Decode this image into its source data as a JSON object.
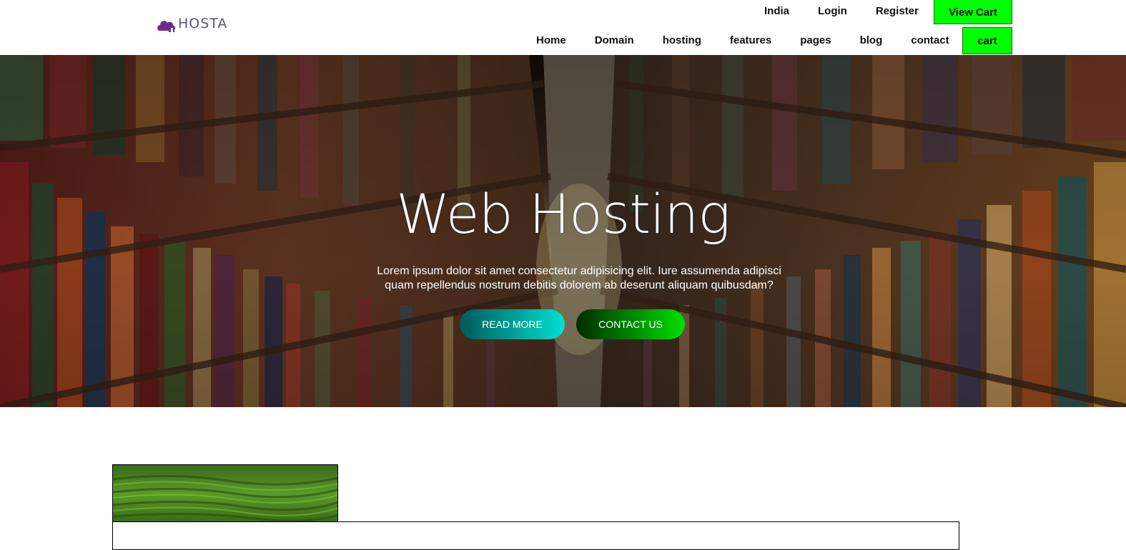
{
  "brand": {
    "logo_text": "HOSTA",
    "logo_icon": "cloud-house-icon",
    "logo_color": "#6a2c91"
  },
  "top_nav": {
    "items": [
      "India",
      "Login",
      "Register"
    ],
    "view_cart_label": "View Cart"
  },
  "main_nav": {
    "items": [
      "Home",
      "Domain",
      "hosting",
      "features",
      "pages",
      "blog",
      "contact"
    ],
    "cart_label": "cart"
  },
  "hero": {
    "title": "Web Hosting",
    "description_line1": "Lorem ipsum dolor sit amet consectetur adipisicing elit. Iure assumenda adipisci",
    "description_line2": "quam repellendus nostrum debitis dolorem ab deserunt aliquam quibusdam?",
    "read_more_label": "READ MORE",
    "contact_label": "CONTACT US"
  },
  "colors": {
    "accent_green": "#00ff00",
    "read_more_gradient": [
      "#005a5a",
      "#00e0d0"
    ],
    "contact_gradient": [
      "#002a00",
      "#00e000"
    ]
  }
}
